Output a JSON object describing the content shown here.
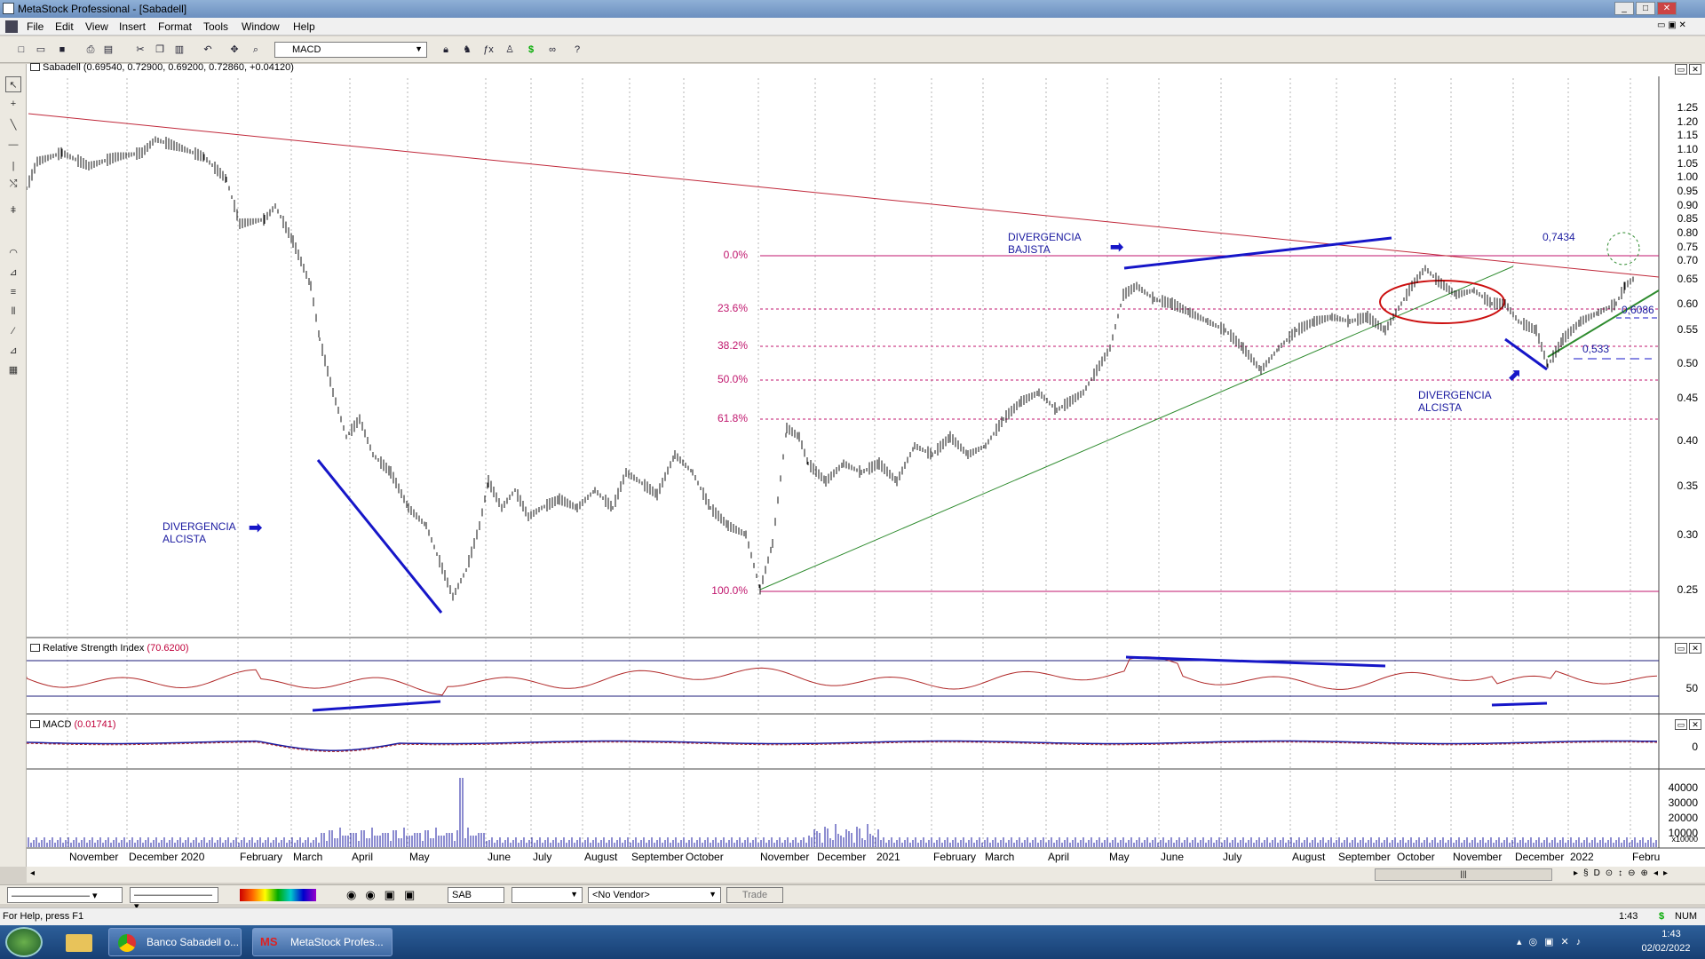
{
  "window": {
    "title": "MetaStock Professional - [Sabadell]"
  },
  "menu": [
    "File",
    "Edit",
    "View",
    "Insert",
    "Format",
    "Tools",
    "Window",
    "Help"
  ],
  "toolbar": {
    "indicator_select": "MACD"
  },
  "price_panel": {
    "header_name": "Sabadell",
    "header_values": "(0.69540, 0.72900, 0.69200, 0.72860, +0.04120)",
    "y_ticks": [
      "1.25",
      "1.20",
      "1.15",
      "1.10",
      "1.05",
      "1.00",
      "0.95",
      "0.90",
      "0.85",
      "0.80",
      "0.75",
      "0.70",
      "0.65",
      "0.60",
      "0.55",
      "0.50",
      "0.45",
      "0.40",
      "0.35",
      "0.30",
      "0.25"
    ],
    "fib_levels": [
      "0.0%",
      "23.6%",
      "38.2%",
      "50.0%",
      "61.8%",
      "100.0%"
    ],
    "annotations": {
      "bearish_div_line1": "DIVERGENCIA",
      "bearish_div_line2": "BAJISTA",
      "bullish_div_left_line1": "DIVERGENCIA",
      "bullish_div_left_line2": "ALCISTA",
      "bullish_div_right_line1": "DIVERGENCIA",
      "bullish_div_right_line2": "ALCISTA",
      "level_top": "0,7434",
      "level_mid": "0,6086",
      "level_low": "0,533"
    }
  },
  "rsi_panel": {
    "header_name": "Relative Strength Index",
    "header_value": "(70.6200)",
    "y_tick": "50"
  },
  "macd_panel": {
    "header_name": "MACD",
    "header_value": "(0.01741)",
    "y_tick": "0"
  },
  "volume_panel": {
    "y_ticks": [
      "40000",
      "30000",
      "20000",
      "10000"
    ],
    "scale": "x10000"
  },
  "x_axis": [
    "November",
    "December 2020",
    "February",
    "March",
    "April",
    "May",
    "June",
    "July",
    "August",
    "September",
    "October",
    "November",
    "December",
    "2021",
    "February",
    "March",
    "April",
    "May",
    "June",
    "July",
    "August",
    "September",
    "October",
    "November",
    "December",
    "2022",
    "Febru"
  ],
  "bottom": {
    "symbol": "SAB",
    "vendor": "<No Vendor>",
    "trade_label": "Trade"
  },
  "status": {
    "help": "For Help, press F1",
    "time": "1:43",
    "num": "NUM"
  },
  "taskbar": {
    "task1": "Banco Sabadell o...",
    "task2": "MetaStock Profes...",
    "clock_time": "1:43",
    "clock_date": "02/02/2022"
  },
  "colors": {
    "trend_line": "#c0283a",
    "support_line": "#2e8b2e",
    "fib": "#c0166d",
    "annot": "#1a1aa0",
    "price": "#000000"
  }
}
